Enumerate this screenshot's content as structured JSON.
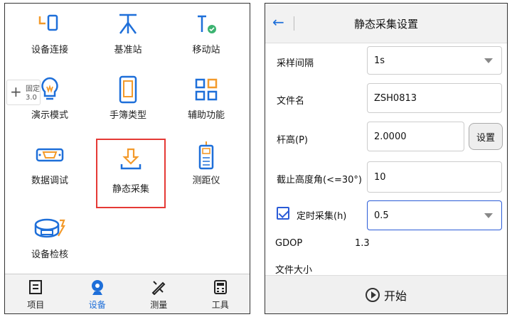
{
  "left": {
    "menu": [
      {
        "label": "设备连接",
        "icon": "device-connect-icon"
      },
      {
        "label": "基准站",
        "icon": "base-station-icon"
      },
      {
        "label": "移动站",
        "icon": "rover-icon"
      },
      {
        "label": "演示模式",
        "icon": "bulb-icon"
      },
      {
        "label": "手簿类型",
        "icon": "handheld-icon"
      },
      {
        "label": "辅助功能",
        "icon": "grid-icon"
      },
      {
        "label": "数据调试",
        "icon": "serial-port-icon"
      },
      {
        "label": "静态采集",
        "icon": "download-tray-icon"
      },
      {
        "label": "测距仪",
        "icon": "rangefinder-icon"
      },
      {
        "label": "设备检核",
        "icon": "device-check-icon"
      }
    ],
    "float_badge": {
      "line1": "固定",
      "line2": "3.0"
    },
    "bottom_nav": [
      {
        "label": "项目",
        "icon": "project-icon"
      },
      {
        "label": "设备",
        "icon": "device-icon"
      },
      {
        "label": "测量",
        "icon": "measure-icon"
      },
      {
        "label": "工具",
        "icon": "tools-icon"
      }
    ]
  },
  "right": {
    "header": {
      "title": "静态采集设置",
      "back": "←"
    },
    "fields": {
      "interval": {
        "label": "采样间隔",
        "value": "1s"
      },
      "filename": {
        "label": "文件名",
        "value": "ZSH0813"
      },
      "pole_height": {
        "label": "杆高(P)",
        "value": "2.0000",
        "button": "设置"
      },
      "cutoff": {
        "label": "截止高度角(<=30°)",
        "value": "10"
      },
      "timed": {
        "label": "定时采集(h)",
        "value": "0.5",
        "checked": true
      }
    },
    "gdop": {
      "label": "GDOP",
      "value": "1.3"
    },
    "filesize": {
      "label": "文件大小"
    },
    "start": "开始"
  },
  "colors": {
    "accent": "#1e6fd9",
    "orange": "#f39a2b",
    "selected_border": "#e53935",
    "green": "#3cb371"
  }
}
